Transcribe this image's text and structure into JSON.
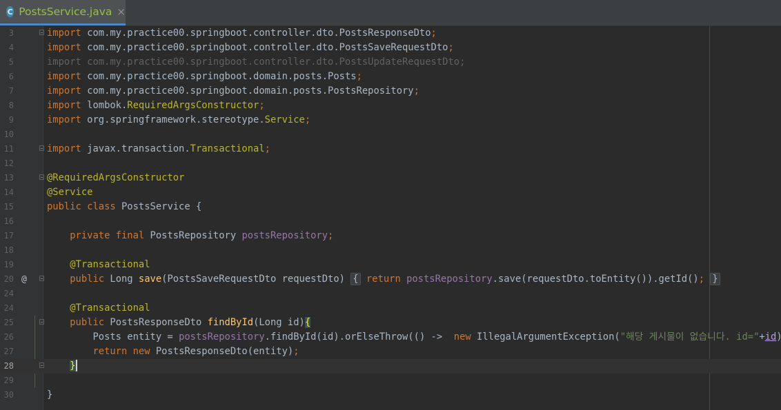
{
  "tab": {
    "icon_letter": "C",
    "file_name": "PostsService.java",
    "close_glyph": "×"
  },
  "gutter": {
    "override_marker": "@"
  },
  "lines": [
    {
      "num": "3",
      "text": "import com.my.practice00.springboot.controller.dto.PostsResponseDto;"
    },
    {
      "num": "4",
      "text": "import com.my.practice00.springboot.controller.dto.PostsSaveRequestDto;"
    },
    {
      "num": "5",
      "text": "import com.my.practice00.springboot.controller.dto.PostsUpdateRequestDto;"
    },
    {
      "num": "6",
      "text": "import com.my.practice00.springboot.domain.posts.Posts;"
    },
    {
      "num": "7",
      "text": "import com.my.practice00.springboot.domain.posts.PostsRepository;"
    },
    {
      "num": "8",
      "text": "import lombok.RequiredArgsConstructor;"
    },
    {
      "num": "9",
      "text": "import org.springframework.stereotype.Service;"
    },
    {
      "num": "10",
      "text": ""
    },
    {
      "num": "11",
      "text": "import javax.transaction.Transactional;"
    },
    {
      "num": "12",
      "text": ""
    },
    {
      "num": "13",
      "text": "@RequiredArgsConstructor"
    },
    {
      "num": "14",
      "text": "@Service"
    },
    {
      "num": "15",
      "text": "public class PostsService {"
    },
    {
      "num": "16",
      "text": ""
    },
    {
      "num": "17",
      "text": "    private final PostsRepository postsRepository;"
    },
    {
      "num": "18",
      "text": ""
    },
    {
      "num": "19",
      "text": "    @Transactional"
    },
    {
      "num": "20",
      "text": "    public Long save(PostsSaveRequestDto requestDto) { return postsRepository.save(requestDto.toEntity()).getId(); }"
    },
    {
      "num": "24",
      "text": ""
    },
    {
      "num": "24",
      "text": "    @Transactional"
    },
    {
      "num": "25",
      "text": "    public PostsResponseDto findById(Long id){"
    },
    {
      "num": "26",
      "text": "        Posts entity = postsRepository.findById(id).orElseThrow(() ->  new IllegalArgumentException(\"해당 게시물이 없습니다. id=\"+id));"
    },
    {
      "num": "27",
      "text": "        return new PostsResponseDto(entity);"
    },
    {
      "num": "28",
      "text": "    }"
    },
    {
      "num": "29",
      "text": ""
    },
    {
      "num": "30",
      "text": "}"
    }
  ]
}
